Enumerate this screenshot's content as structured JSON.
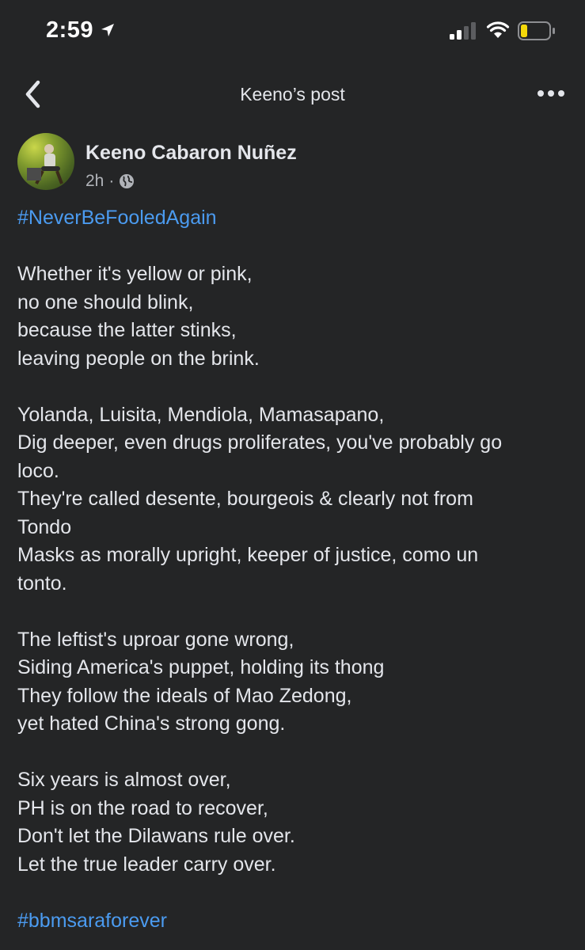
{
  "status_bar": {
    "time": "2:59",
    "icons": [
      "location-arrow-icon",
      "cellular-signal-icon",
      "wifi-icon",
      "battery-low-icon"
    ],
    "battery_color": "#f5d90a"
  },
  "nav": {
    "title": "Keeno’s post",
    "icons": [
      "chevron-left-icon",
      "more-horizontal-icon"
    ]
  },
  "post": {
    "author": "Keeno Cabaron Nuñez",
    "time_ago": "2h",
    "separator": "·",
    "privacy_icon": "globe-icon",
    "hashtag_top": "#NeverBeFooledAgain",
    "stanzas": [
      [
        "Whether it's yellow or pink,",
        "no one should blink,",
        "because the latter stinks,",
        "leaving people on the brink."
      ],
      [
        "Yolanda, Luisita, Mendiola, Mamasapano,",
        "Dig deeper, even drugs proliferates, you've probably go",
        "loco.",
        "They're called desente, bourgeois & clearly not from",
        "Tondo",
        "Masks as morally upright, keeper of justice, como un",
        "tonto."
      ],
      [
        "The leftist's uproar gone wrong,",
        "Siding America's puppet, holding its thong",
        "They follow the ideals of Mao Zedong,",
        "yet hated China's strong gong."
      ],
      [
        "Six years is almost over,",
        "PH is on the road to recover,",
        "Don't let the Dilawans rule over.",
        "Let the true leader carry over."
      ]
    ],
    "hashtag_bottom": "#bbmsaraforever"
  },
  "colors": {
    "background": "#242526",
    "text": "#e4e6eb",
    "secondary_text": "#b0b3b8",
    "link": "#4b9bf0"
  }
}
